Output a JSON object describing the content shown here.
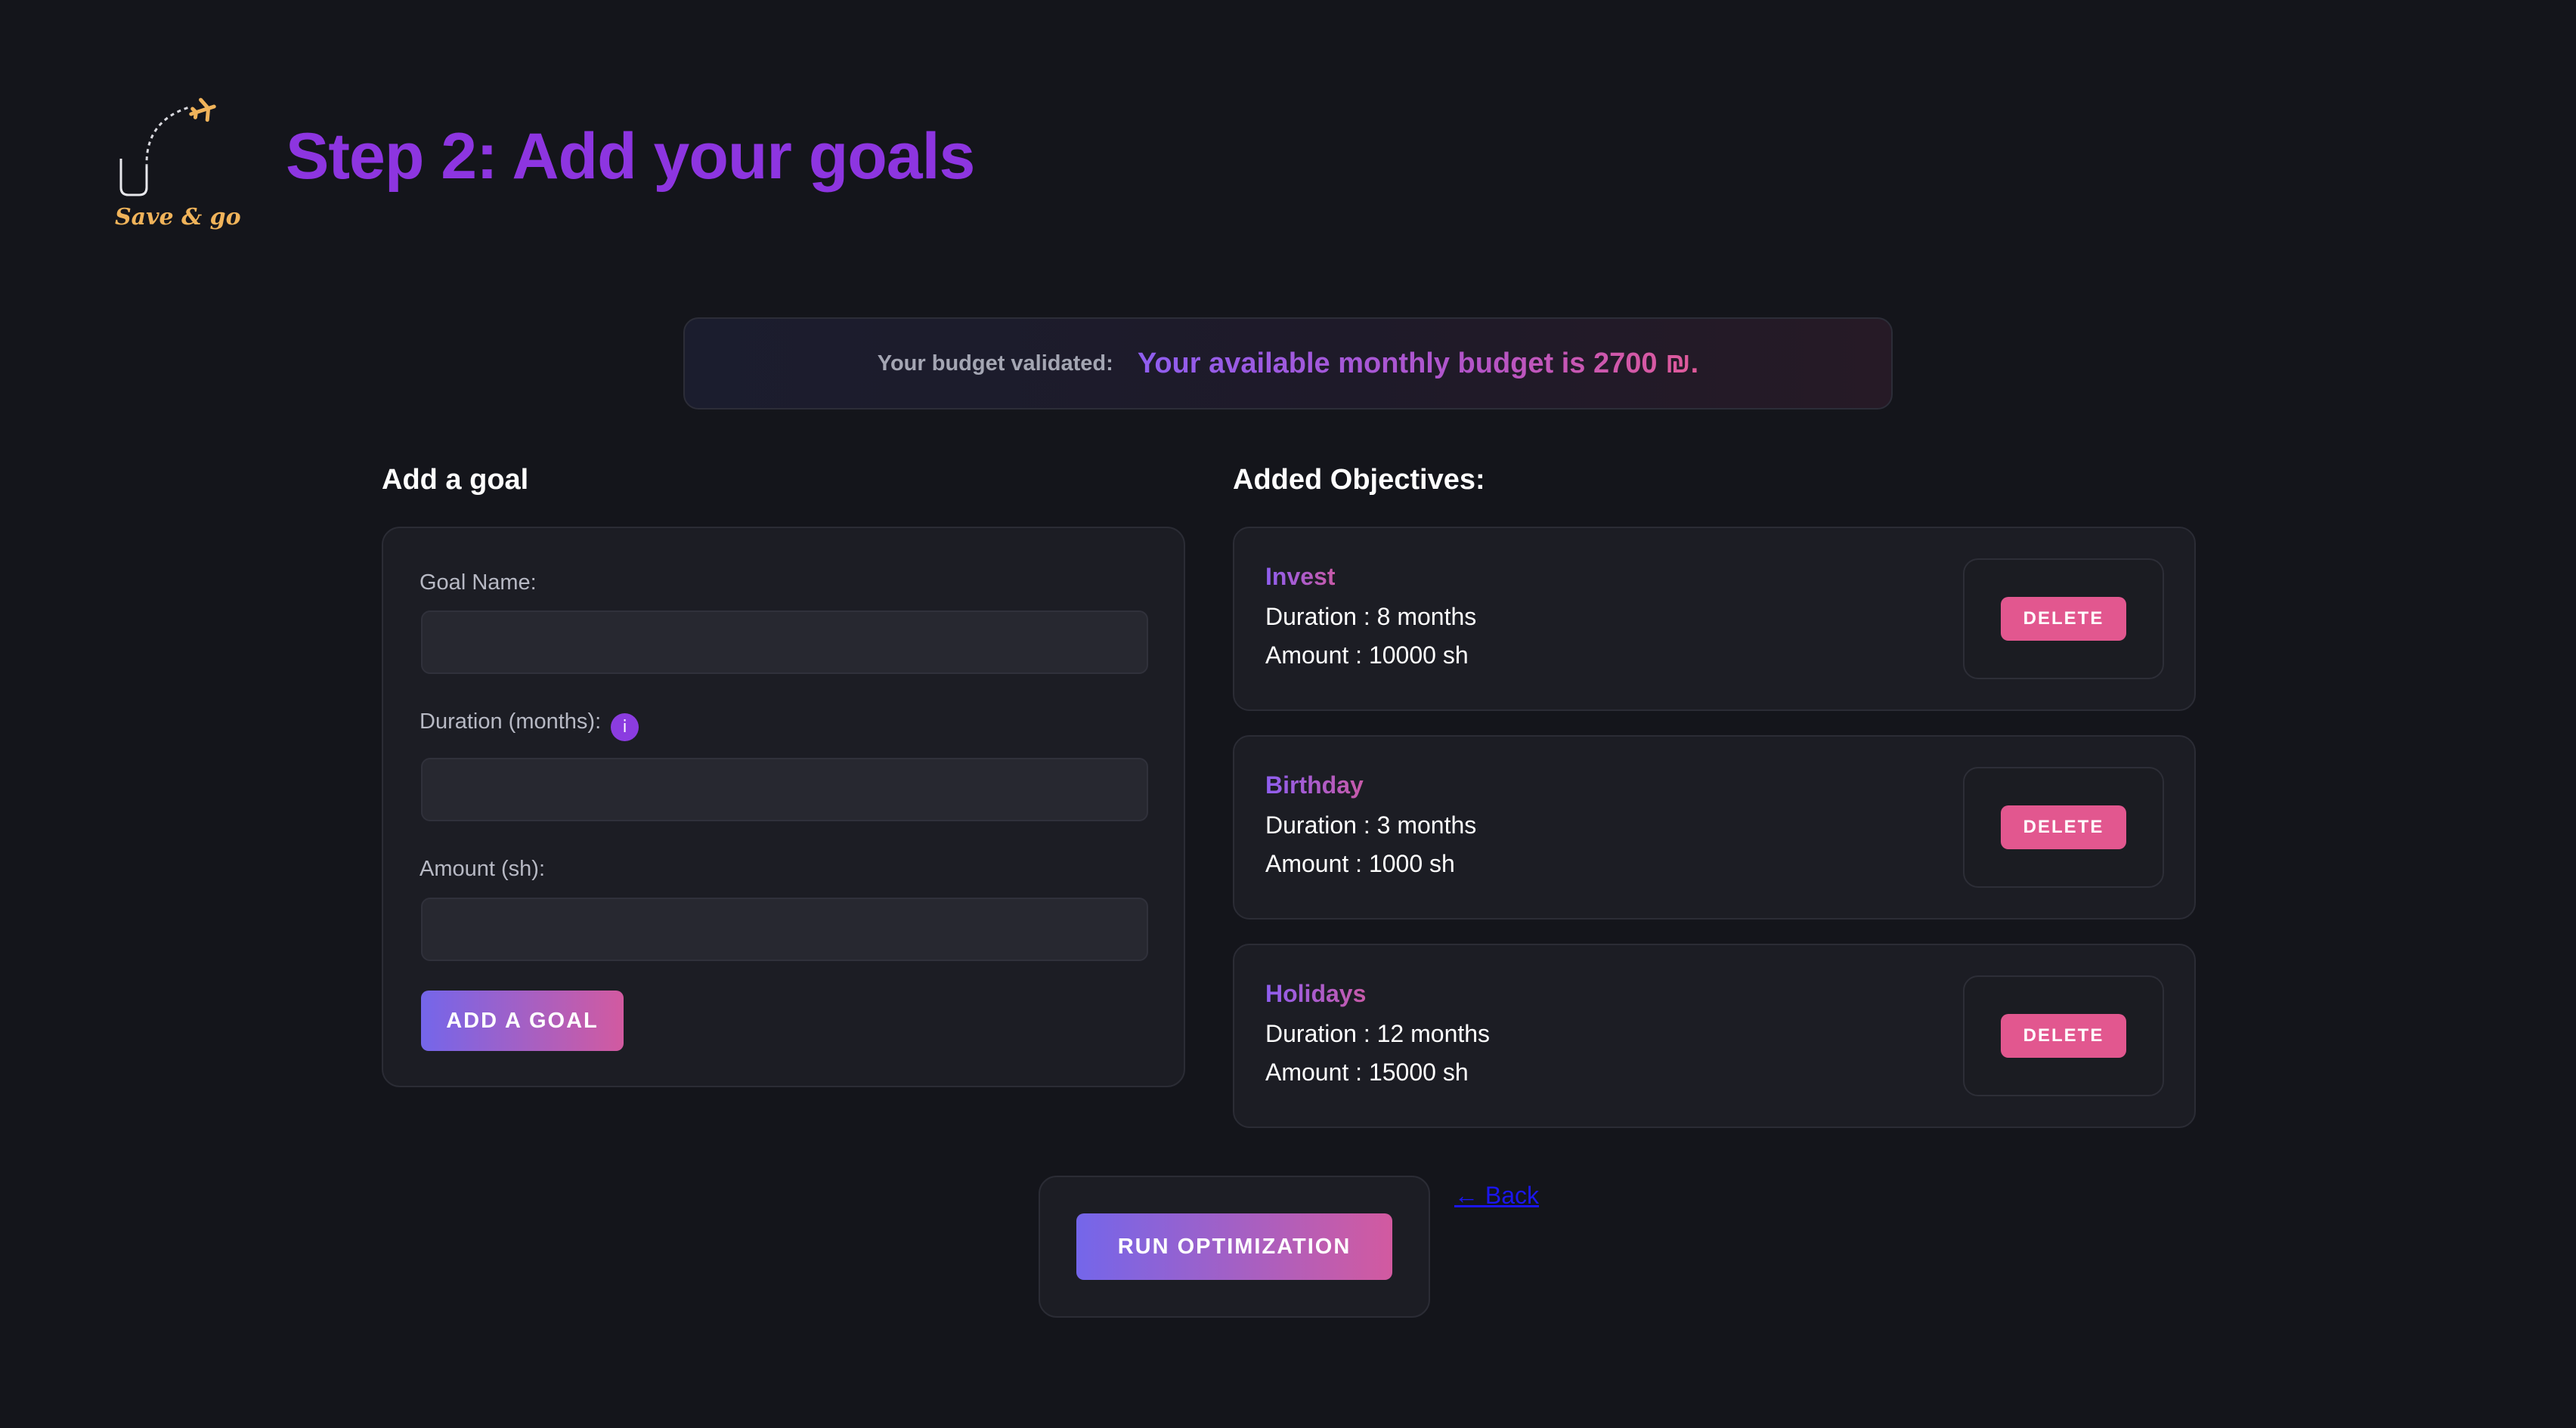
{
  "app": {
    "logo_text": "Save & go",
    "page_title": "Step 2: Add your goals"
  },
  "budget": {
    "label": "Your budget validated:",
    "message": "Your available monthly budget is 2700 ₪."
  },
  "form": {
    "title": "Add a goal",
    "goal_name_label": "Goal Name:",
    "goal_name_value": "",
    "duration_label": "Duration (months):",
    "duration_value": "",
    "info_icon_glyph": "i",
    "amount_label": "Amount (sh):",
    "amount_value": "",
    "submit_label": "ADD A GOAL"
  },
  "objectives": {
    "title": "Added Objectives:",
    "items": [
      {
        "name": "Invest",
        "duration": "Duration : 8 months",
        "amount": "Amount : 10000 sh",
        "delete_label": "DELETE"
      },
      {
        "name": "Birthday",
        "duration": "Duration : 3 months",
        "amount": "Amount : 1000 sh",
        "delete_label": "DELETE"
      },
      {
        "name": "Holidays",
        "duration": "Duration : 12 months",
        "amount": "Amount : 15000 sh",
        "delete_label": "DELETE"
      }
    ]
  },
  "actions": {
    "run_label": "RUN OPTIMIZATION",
    "back_label": "← Back"
  },
  "colors": {
    "background": "#14151b",
    "title_purple": "#8d35e0",
    "accent_gradient_start": "#7466ea",
    "accent_gradient_end": "#d25aa0",
    "delete_pink": "#e2578f",
    "logo_gold": "#f0b35a",
    "link_blue": "#1b16f0"
  },
  "icons": {
    "logo": "plane-path-logo-icon",
    "info": "info-icon"
  }
}
